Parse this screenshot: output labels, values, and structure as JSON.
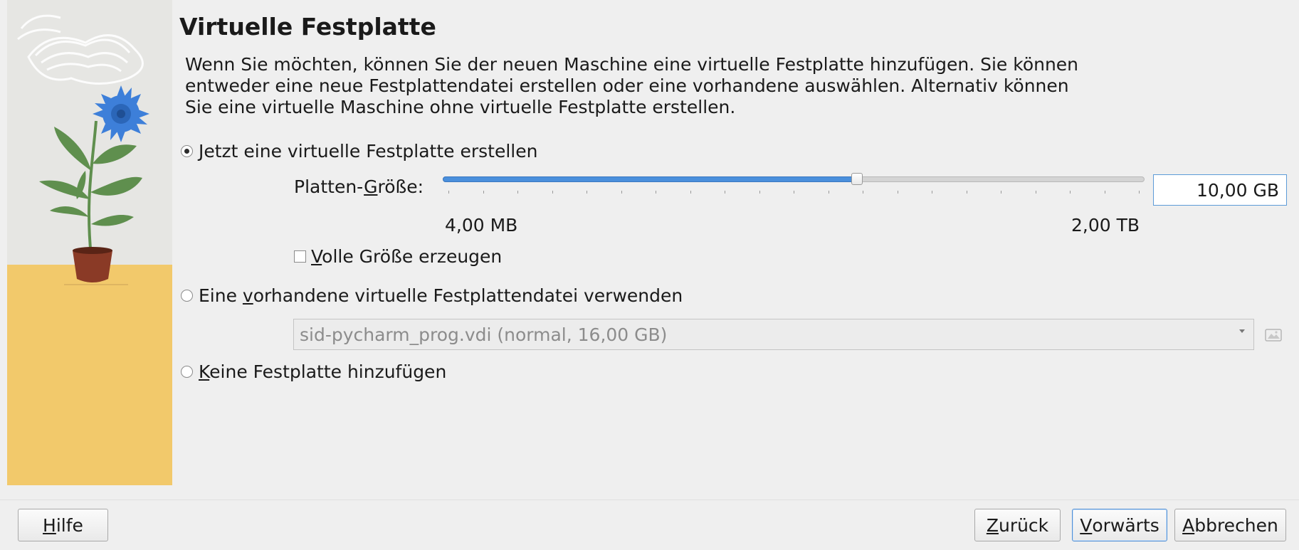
{
  "dialog": {
    "title": "Virtuelle Festplatte",
    "description": "Wenn Sie möchten, können Sie der neuen Maschine eine virtuelle Festplatte hinzufügen. Sie können\nentweder eine neue Festplattendatei erstellen oder eine vorhandene auswählen. Alternativ können\nSie eine virtuelle Maschine ohne virtuelle Festplatte erstellen."
  },
  "options": {
    "create_new": {
      "mnemonic": "J",
      "rest": "etzt eine virtuelle Festplatte erstellen",
      "selected": true
    },
    "use_existing": {
      "prefix": "Eine ",
      "mnemonic": "v",
      "rest": "orhandene virtuelle Festplattendatei verwenden",
      "selected": false
    },
    "no_disk": {
      "mnemonic": "K",
      "rest": "eine Festplatte hinzufügen",
      "selected": false
    }
  },
  "disk_size": {
    "label_prefix": "Platten-",
    "label_mnemonic": "G",
    "label_rest": "röße:",
    "value": "10,00 GB",
    "range_min": "4,00 MB",
    "range_max": "2,00 TB",
    "slider_fraction": 0.59
  },
  "full_size": {
    "mnemonic": "V",
    "rest": "olle Größe erzeugen",
    "checked": false
  },
  "existing_file": {
    "selected": "sid-pycharm_prog.vdi (normal, 16,00 GB)"
  },
  "buttons": {
    "help": {
      "mnemonic": "H",
      "rest": "ilfe"
    },
    "back": {
      "mnemonic": "Z",
      "rest": "urück"
    },
    "next": {
      "mnemonic": "V",
      "rest": "orwärts"
    },
    "cancel": {
      "mnemonic": "A",
      "rest": "bbrechen"
    }
  },
  "colors": {
    "accent": "#4a8fdc",
    "panel_floor": "#f2c96b",
    "panel_wall": "#e6e6e3",
    "flower": "#3d7fd9",
    "leaf": "#5f8f4e",
    "pot": "#8a3a26"
  },
  "icons": {
    "side_illustration": "potted-flower-illustration",
    "folder": "folder-open-icon",
    "combo_arrow": "chevron-down-icon"
  }
}
